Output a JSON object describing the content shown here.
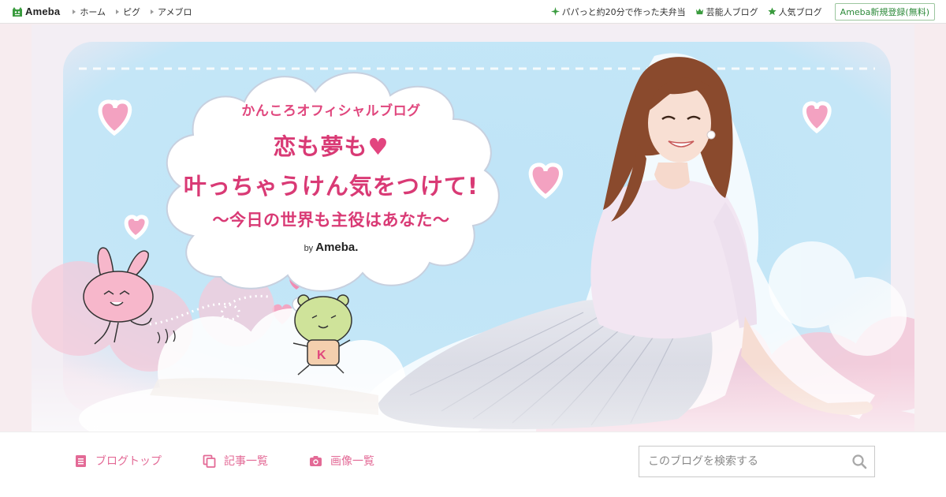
{
  "topbar": {
    "logo_text": "Ameba",
    "nav_left": [
      {
        "label": "ホーム"
      },
      {
        "label": "ピグ"
      },
      {
        "label": "アメブロ"
      }
    ],
    "nav_right": [
      {
        "label": "パパっと約20分で作った夫弁当",
        "icon": "sparkle-icon"
      },
      {
        "label": "芸能人ブログ",
        "icon": "crown-icon"
      },
      {
        "label": "人気ブログ",
        "icon": "star-icon"
      }
    ],
    "register_label": "Ameba新規登録(無料)"
  },
  "hero": {
    "blog_name": "かんころオフィシャルブログ",
    "catch_line1": "恋も夢も",
    "catch_heart": "♥",
    "catch_line2": "叶っちゃうけん気をつけて!",
    "catch_line3": "～今日の世界も主役はあなた～",
    "by_label": "by",
    "by_brand": "Ameba."
  },
  "bottombar": {
    "tabs": [
      {
        "label": "ブログトップ",
        "icon": "document-icon"
      },
      {
        "label": "記事一覧",
        "icon": "copy-icon"
      },
      {
        "label": "画像一覧",
        "icon": "camera-icon"
      }
    ],
    "search": {
      "placeholder": "このブログを検索する"
    }
  },
  "colors": {
    "accent_pink": "#e36a96",
    "title_pink": "#d93a75",
    "ameba_green": "#2d8a3a",
    "sky_blue": "#bfe3f5"
  }
}
